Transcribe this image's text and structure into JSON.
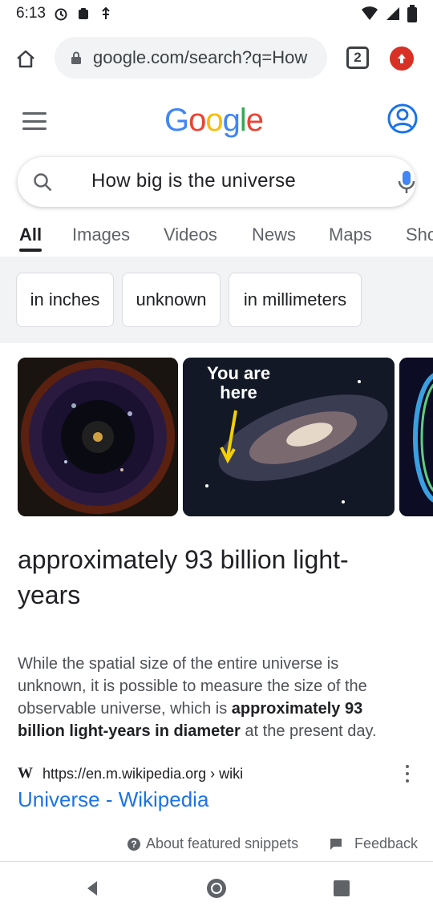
{
  "status_bar": {
    "time": "6:13"
  },
  "browser": {
    "url": "google.com/search?q=How",
    "tab_count": "2"
  },
  "search": {
    "query": "How big is the universe"
  },
  "tabs": [
    {
      "label": "All"
    },
    {
      "label": "Images"
    },
    {
      "label": "Videos"
    },
    {
      "label": "News"
    },
    {
      "label": "Maps"
    },
    {
      "label": "Sho"
    }
  ],
  "chips": [
    {
      "label": "in inches"
    },
    {
      "label": "unknown"
    },
    {
      "label": "in millimeters"
    }
  ],
  "images": {
    "caption_1": "You are",
    "caption_2": "here"
  },
  "answer": {
    "text": "approximately 93 billion light-years"
  },
  "snippet": {
    "part1": "While the spatial size of the entire universe is unknown, it is possible to measure the size of the observable universe, which is ",
    "bold": "approximately 93 billion light-years in diameter",
    "part2": " at the present day."
  },
  "source": {
    "icon_letter": "W",
    "breadcrumb": "https://en.m.wikipedia.org › wiki",
    "title": "Universe - Wikipedia"
  },
  "footer": {
    "about": "About featured snippets",
    "feedback": "Feedback"
  },
  "colors": {
    "link": "#1a73e8",
    "chip_bg": "#f1f3f4",
    "update_red": "#d93025"
  }
}
